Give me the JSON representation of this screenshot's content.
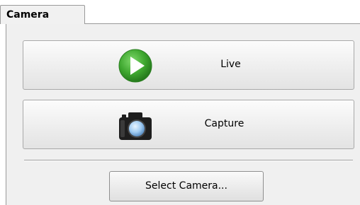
{
  "tab": {
    "label": "Camera"
  },
  "buttons": {
    "live": {
      "label": "Live",
      "icon": "play-icon",
      "icon_color": "#3a9f2c"
    },
    "capture": {
      "label": "Capture",
      "icon": "camera-icon"
    },
    "select_camera": {
      "label": "Select Camera..."
    }
  }
}
